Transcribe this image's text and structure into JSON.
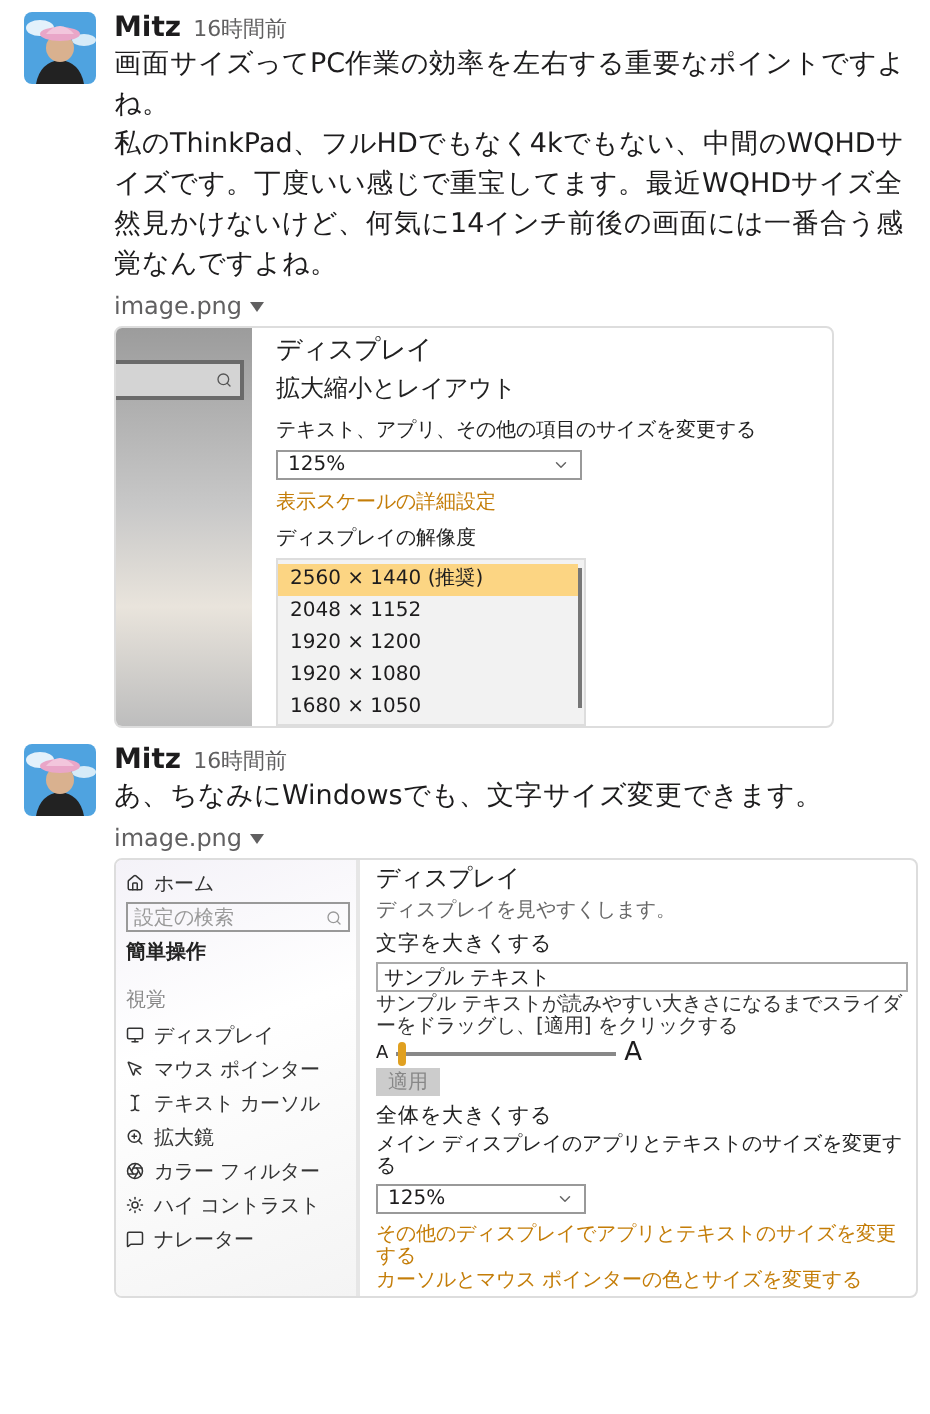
{
  "messages": [
    {
      "author": "Mitz",
      "time": "16時間前",
      "paragraphs": [
        "画面サイズってPC作業の効率を左右する重要なポイントですよね。",
        "私のThinkPad、フルHDでもなく4kでもない、中間のWQHDサイズです。丁度いい感じで重宝してます。最近WQHDサイズ全然見かけないけど、何気に14インチ前後の画面には一番合う感覚なんですよね。"
      ],
      "attachment": {
        "filename": "image.png",
        "screenshot": {
          "kind": "scale_settings",
          "heading": "ディスプレイ",
          "section": "拡大縮小とレイアウト",
          "size_label": "テキスト、アプリ、その他の項目のサイズを変更する",
          "size_value": "125%",
          "advanced_link": "表示スケールの詳細設定",
          "resolution_label": "ディスプレイの解像度",
          "resolutions": [
            {
              "label": "2560 × 1440 (推奨)",
              "selected": true
            },
            {
              "label": "2048 × 1152",
              "selected": false
            },
            {
              "label": "1920 × 1200",
              "selected": false
            },
            {
              "label": "1920 × 1080",
              "selected": false
            },
            {
              "label": "1680 × 1050",
              "selected": false
            }
          ]
        }
      }
    },
    {
      "author": "Mitz",
      "time": "16時間前",
      "paragraphs": [
        "あ、ちなみにWindowsでも、文字サイズ変更できます。"
      ],
      "attachment": {
        "filename": "image.png",
        "screenshot": {
          "kind": "ease_of_access",
          "home": "ホーム",
          "search_placeholder": "設定の検索",
          "category": "簡単操作",
          "group": "視覚",
          "nav": [
            "ディスプレイ",
            "マウス ポインター",
            "テキスト カーソル",
            "拡大鏡",
            "カラー フィルター",
            "ハイ コントラスト",
            "ナレーター"
          ],
          "heading": "ディスプレイ",
          "subtitle": "ディスプレイを見やすくします。",
          "text_section": "文字を大きくする",
          "sample_value": "サンプル テキスト",
          "instructions": "サンプル テキストが読みやすい大きさになるまでスライダーをドラッグし、[適用] をクリックする",
          "slider_small": "A",
          "slider_large": "A",
          "slider": {
            "level": 0.03
          },
          "apply": {
            "label": "適用",
            "disabled": true
          },
          "all_section": "全体を大きくする",
          "scale_label": "メイン ディスプレイのアプリとテキストのサイズを変更する",
          "scale_value": "125%",
          "links": [
            "その他のディスプレイでアプリとテキストのサイズを変更する",
            "カーソルとマウス ポインターの色とサイズを変更する"
          ]
        }
      }
    }
  ]
}
